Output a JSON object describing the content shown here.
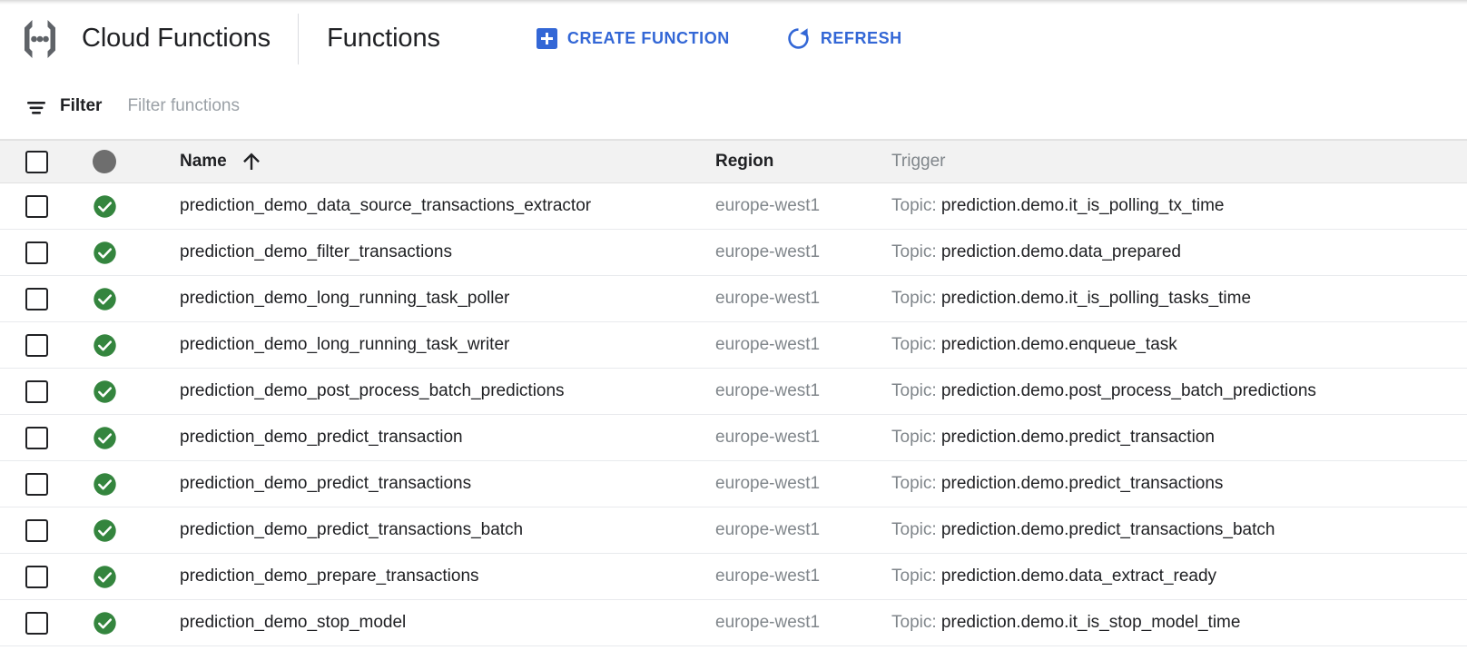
{
  "header": {
    "product_name": "Cloud Functions",
    "section_title": "Functions",
    "logo_icon": "cloud-functions-logo",
    "actions": [
      {
        "label": "CREATE FUNCTION",
        "icon": "plus-box-icon"
      },
      {
        "label": "REFRESH",
        "icon": "refresh-icon"
      }
    ],
    "accent_color": "#3367d6"
  },
  "filter": {
    "icon": "filter-icon",
    "label": "Filter",
    "placeholder": "Filter functions",
    "value": ""
  },
  "table": {
    "columns": {
      "select_all": "select-all-checkbox",
      "status": "status-circle",
      "name": "Name",
      "region": "Region",
      "trigger": "Trigger"
    },
    "sort": {
      "column": "Name",
      "direction": "ascending",
      "icon": "arrow-up-icon"
    },
    "status_ok_color": "#34853e",
    "rows": [
      {
        "status": "ok",
        "name": "prediction_demo_data_source_transactions_extractor",
        "region": "europe-west1",
        "trigger_prefix": "Topic: ",
        "trigger_value": "prediction.demo.it_is_polling_tx_time"
      },
      {
        "status": "ok",
        "name": "prediction_demo_filter_transactions",
        "region": "europe-west1",
        "trigger_prefix": "Topic: ",
        "trigger_value": "prediction.demo.data_prepared"
      },
      {
        "status": "ok",
        "name": "prediction_demo_long_running_task_poller",
        "region": "europe-west1",
        "trigger_prefix": "Topic: ",
        "trigger_value": "prediction.demo.it_is_polling_tasks_time"
      },
      {
        "status": "ok",
        "name": "prediction_demo_long_running_task_writer",
        "region": "europe-west1",
        "trigger_prefix": "Topic: ",
        "trigger_value": "prediction.demo.enqueue_task"
      },
      {
        "status": "ok",
        "name": "prediction_demo_post_process_batch_predictions",
        "region": "europe-west1",
        "trigger_prefix": "Topic: ",
        "trigger_value": "prediction.demo.post_process_batch_predictions"
      },
      {
        "status": "ok",
        "name": "prediction_demo_predict_transaction",
        "region": "europe-west1",
        "trigger_prefix": "Topic: ",
        "trigger_value": "prediction.demo.predict_transaction"
      },
      {
        "status": "ok",
        "name": "prediction_demo_predict_transactions",
        "region": "europe-west1",
        "trigger_prefix": "Topic: ",
        "trigger_value": "prediction.demo.predict_transactions"
      },
      {
        "status": "ok",
        "name": "prediction_demo_predict_transactions_batch",
        "region": "europe-west1",
        "trigger_prefix": "Topic: ",
        "trigger_value": "prediction.demo.predict_transactions_batch"
      },
      {
        "status": "ok",
        "name": "prediction_demo_prepare_transactions",
        "region": "europe-west1",
        "trigger_prefix": "Topic: ",
        "trigger_value": "prediction.demo.data_extract_ready"
      },
      {
        "status": "ok",
        "name": "prediction_demo_stop_model",
        "region": "europe-west1",
        "trigger_prefix": "Topic: ",
        "trigger_value": "prediction.demo.it_is_stop_model_time"
      }
    ]
  }
}
